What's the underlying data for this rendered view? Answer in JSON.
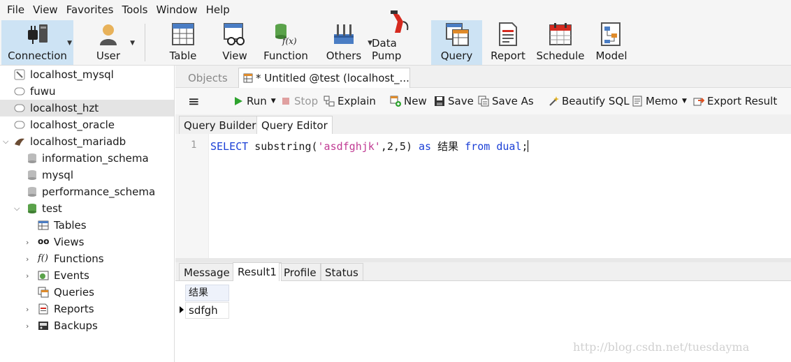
{
  "menu": [
    "File",
    "View",
    "Favorites",
    "Tools",
    "Window",
    "Help"
  ],
  "toolbar": {
    "connection": "Connection",
    "user": "User",
    "table": "Table",
    "view": "View",
    "function": "Function",
    "others": "Others",
    "data_pump": "Data Pump",
    "query": "Query",
    "report": "Report",
    "schedule": "Schedule",
    "model": "Model",
    "function_icon_text": "f(x)"
  },
  "nav": {
    "items": [
      {
        "label": "localhost_mysql"
      },
      {
        "label": "fuwu"
      },
      {
        "label": "localhost_hzt"
      },
      {
        "label": "localhost_oracle"
      },
      {
        "label": "localhost_mariadb"
      },
      {
        "label": "information_schema"
      },
      {
        "label": "mysql"
      },
      {
        "label": "performance_schema"
      },
      {
        "label": "test"
      },
      {
        "label": "Tables"
      },
      {
        "label": "Views"
      },
      {
        "label": "Functions"
      },
      {
        "label": "Events"
      },
      {
        "label": "Queries"
      },
      {
        "label": "Reports"
      },
      {
        "label": "Backups"
      }
    ],
    "views_icon_text": "oo",
    "functions_icon_text": "f()"
  },
  "tabs": {
    "objects": "Objects",
    "untitled": "* Untitled @test (localhost_..."
  },
  "query_toolbar": {
    "menu_icon": "≡",
    "run": "Run",
    "stop": "Stop",
    "explain": "Explain",
    "new": "New",
    "save": "Save",
    "save_as": "Save As",
    "beautify": "Beautify SQL",
    "memo": "Memo",
    "export": "Export Result"
  },
  "subtabs": {
    "builder": "Query Builder",
    "editor": "Query Editor"
  },
  "editor": {
    "line_no": "1",
    "tokens": {
      "select": "SELECT",
      "func": " substring(",
      "str": "'asdfghjk'",
      "args": ",2,5) ",
      "as": "as",
      "alias": " 结果 ",
      "from": "from",
      "sp": " ",
      "dual": "dual",
      "semi": ";"
    }
  },
  "result_tabs": {
    "message": "Message",
    "result1": "Result1",
    "profile": "Profile",
    "status": "Status"
  },
  "results": {
    "header": "结果",
    "rows": [
      [
        "sdfgh"
      ]
    ]
  },
  "watermark": "http://blog.csdn.net/tuesdayma"
}
